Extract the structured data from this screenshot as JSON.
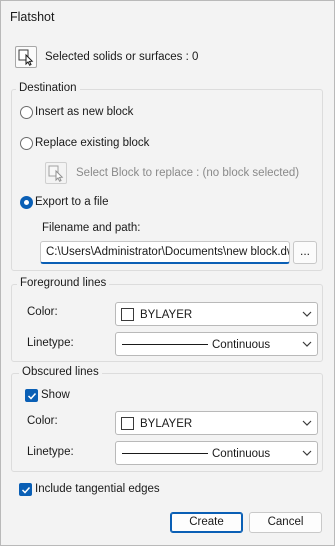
{
  "window": {
    "title": "Flatshot"
  },
  "selection": {
    "label": "Selected solids or surfaces : 0",
    "icon": "select-objects-icon"
  },
  "destination": {
    "label": "Destination",
    "insert_label": "Insert as new block",
    "replace_label": "Replace existing block",
    "select_block_label": "Select Block to replace : (no block selected)",
    "export_label": "Export to a file",
    "selected_option": "export",
    "filename_label": "Filename and path:",
    "filename_value": "C:\\Users\\Administrator\\Documents\\new block.dwg",
    "browse_label": "..."
  },
  "foreground": {
    "label": "Foreground lines",
    "color_label": "Color:",
    "color_value": "BYLAYER",
    "linetype_label": "Linetype:",
    "linetype_value": "Continuous"
  },
  "obscured": {
    "label": "Obscured lines",
    "show_label": "Show",
    "show_checked": true,
    "color_label": "Color:",
    "color_value": "BYLAYER",
    "linetype_label": "Linetype:",
    "linetype_value": "Continuous"
  },
  "tangential": {
    "label": "Include tangential edges",
    "checked": true
  },
  "buttons": {
    "create": "Create",
    "cancel": "Cancel"
  },
  "colors": {
    "accent": "#0a5fb5",
    "background": "#f3f3f3"
  }
}
